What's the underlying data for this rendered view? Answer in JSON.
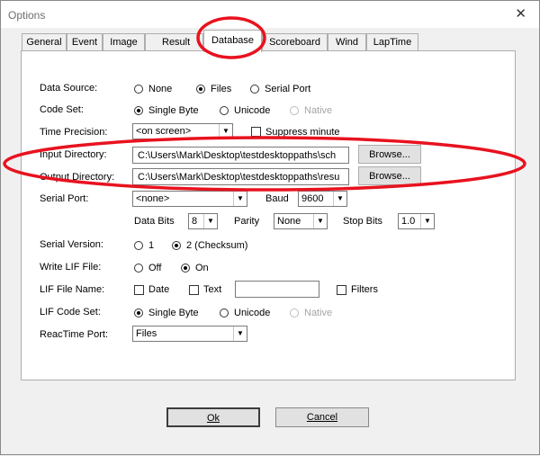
{
  "window": {
    "title": "Options",
    "close_glyph": "✕"
  },
  "tabs": [
    "General",
    "Event",
    "Image",
    "Result",
    "Database",
    "Scoreboard",
    "Wind",
    "LapTime"
  ],
  "active_tab": "Database",
  "data_source": {
    "label": "Data Source:",
    "options": [
      "None",
      "Files",
      "Serial Port"
    ],
    "selected": "Files"
  },
  "code_set": {
    "label": "Code Set:",
    "options": [
      "Single Byte",
      "Unicode",
      "Native"
    ],
    "selected": "Single Byte",
    "disabled": [
      "Native"
    ]
  },
  "time_precision": {
    "label": "Time Precision:",
    "value": "<on screen>",
    "suppress_label": "Suppress minute"
  },
  "input_directory": {
    "label": "Input Directory:",
    "value": "C:\\Users\\Mark\\Desktop\\testdesktoppaths\\sch",
    "browse": "Browse..."
  },
  "output_directory": {
    "label": "Output Directory:",
    "value": "C:\\Users\\Mark\\Desktop\\testdesktoppaths\\resu",
    "browse": "Browse..."
  },
  "serial_port": {
    "label": "Serial Port:",
    "value": "<none>"
  },
  "baud": {
    "label": "Baud",
    "value": "9600"
  },
  "data_bits": {
    "label": "Data Bits",
    "value": "8"
  },
  "parity": {
    "label": "Parity",
    "value": "None"
  },
  "stop_bits": {
    "label": "Stop Bits",
    "value": "1.0"
  },
  "serial_version": {
    "label": "Serial Version:",
    "options": [
      "1",
      "2 (Checksum)"
    ],
    "selected": "2 (Checksum)"
  },
  "write_lif": {
    "label": "Write LIF File:",
    "options": [
      "Off",
      "On"
    ],
    "selected": "On"
  },
  "lif_file_name": {
    "label": "LIF File Name:",
    "date": "Date",
    "text": "Text",
    "text_value": "",
    "filters": "Filters"
  },
  "lif_code_set": {
    "label": "LIF Code Set:",
    "options": [
      "Single Byte",
      "Unicode",
      "Native"
    ],
    "selected": "Single Byte",
    "disabled": [
      "Native"
    ]
  },
  "reactime_port": {
    "label": "ReacTime Port:",
    "value": "Files"
  },
  "buttons": {
    "ok": "Ok",
    "cancel": "Cancel"
  },
  "dropdown_glyph": "▼",
  "colors": {
    "annotation": "#e8121f"
  }
}
